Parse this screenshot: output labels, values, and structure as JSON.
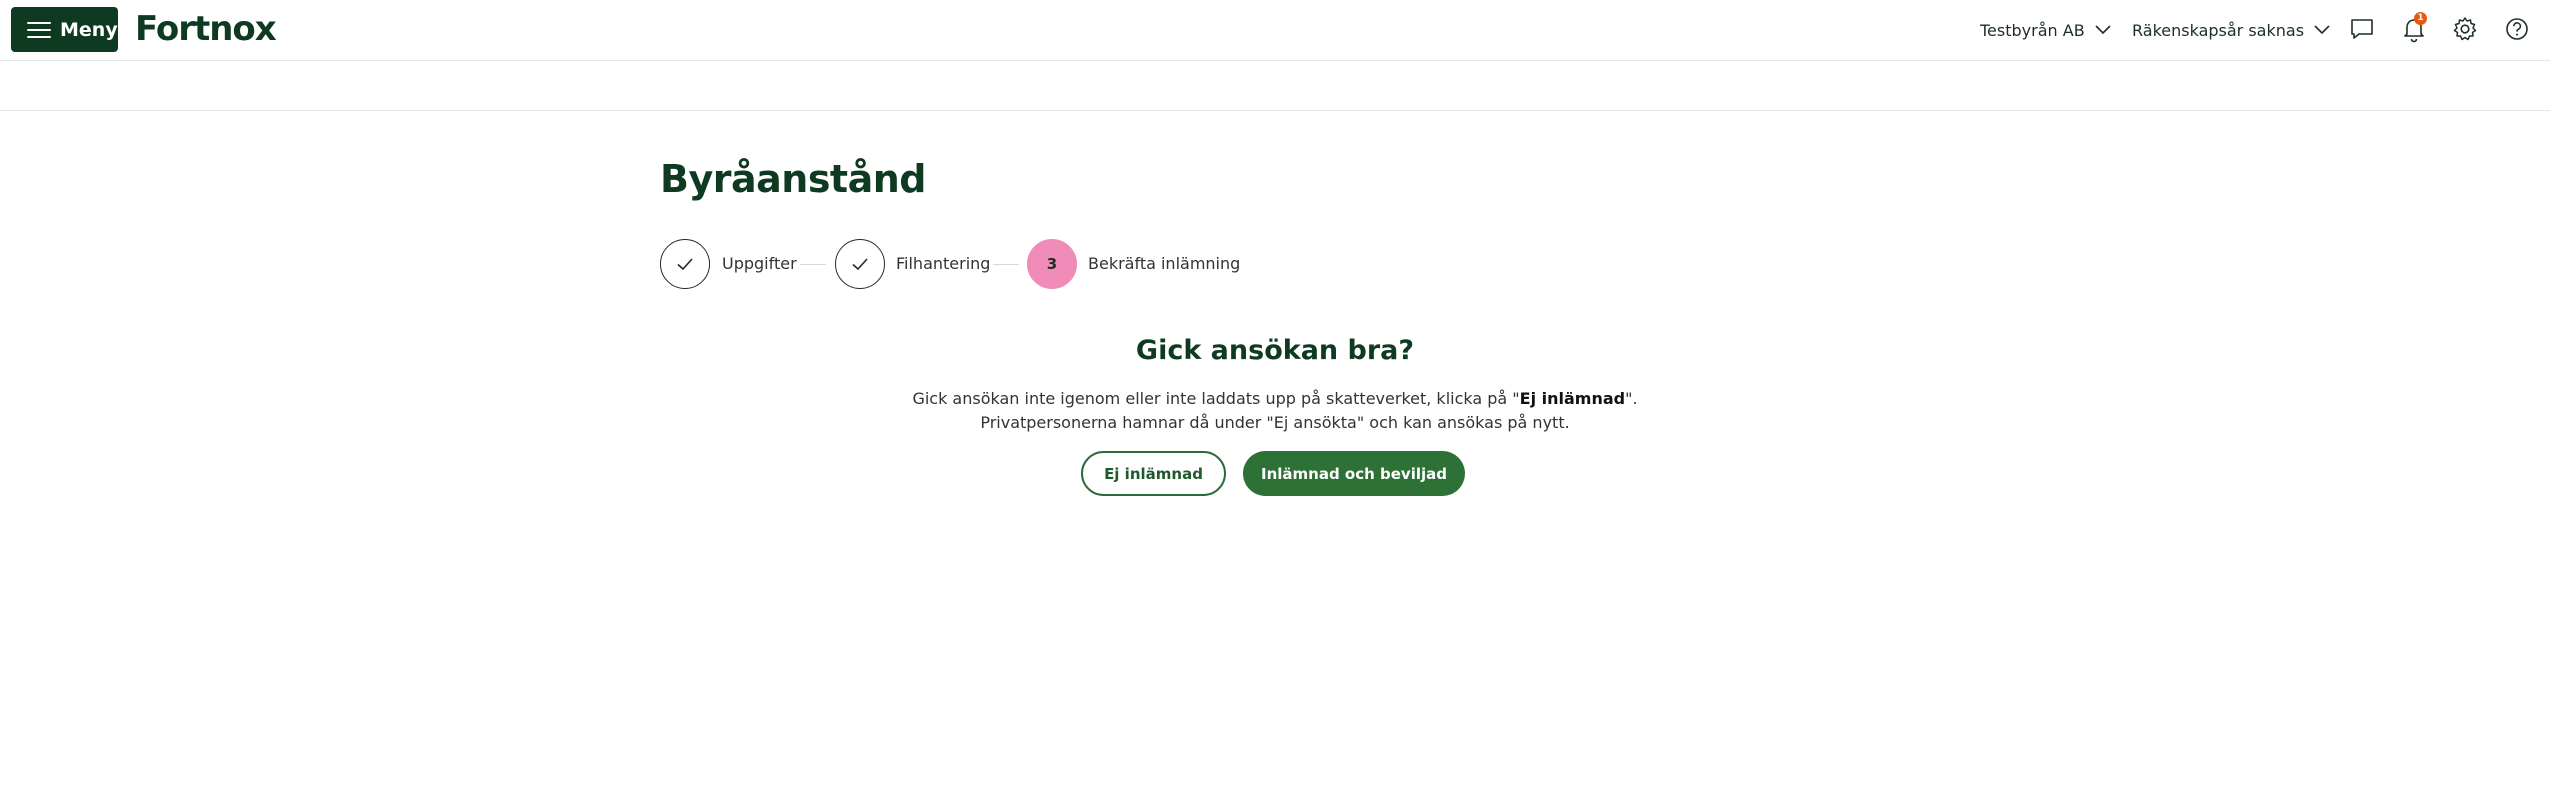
{
  "header": {
    "menu_label": "Meny",
    "logo_text": "Fortnox",
    "company": "Testbyrån AB",
    "fiscal_year": "Räkenskapsår saknas",
    "notification_count": "1",
    "icons": [
      "menu-icon",
      "chat-icon",
      "bell-icon",
      "gear-icon",
      "help-icon"
    ],
    "brand_color": "#0f3a22",
    "badge_color": "#e35a12"
  },
  "page": {
    "title": "Byråanstånd",
    "steps": [
      {
        "label": "Uppgifter",
        "state": "done"
      },
      {
        "label": "Filhantering",
        "state": "done"
      },
      {
        "label": "Bekräfta inlämning",
        "state": "active",
        "number": "3"
      }
    ],
    "step_active_color": "#f08cb7",
    "question": "Gick ansökan bra?",
    "description_line1_pre": "Gick ansökan inte igenom eller inte laddats upp på skatteverket, klicka på \"",
    "description_line1_bold": "Ej inlämnad",
    "description_line1_post": "\".",
    "description_line2": "Privatpersonerna hamnar då under \"Ej ansökta\" och kan ansökas på nytt.",
    "button_secondary": "Ej inlämnad",
    "button_primary": "Inlämnad och beviljad",
    "primary_color": "#2e7137"
  }
}
